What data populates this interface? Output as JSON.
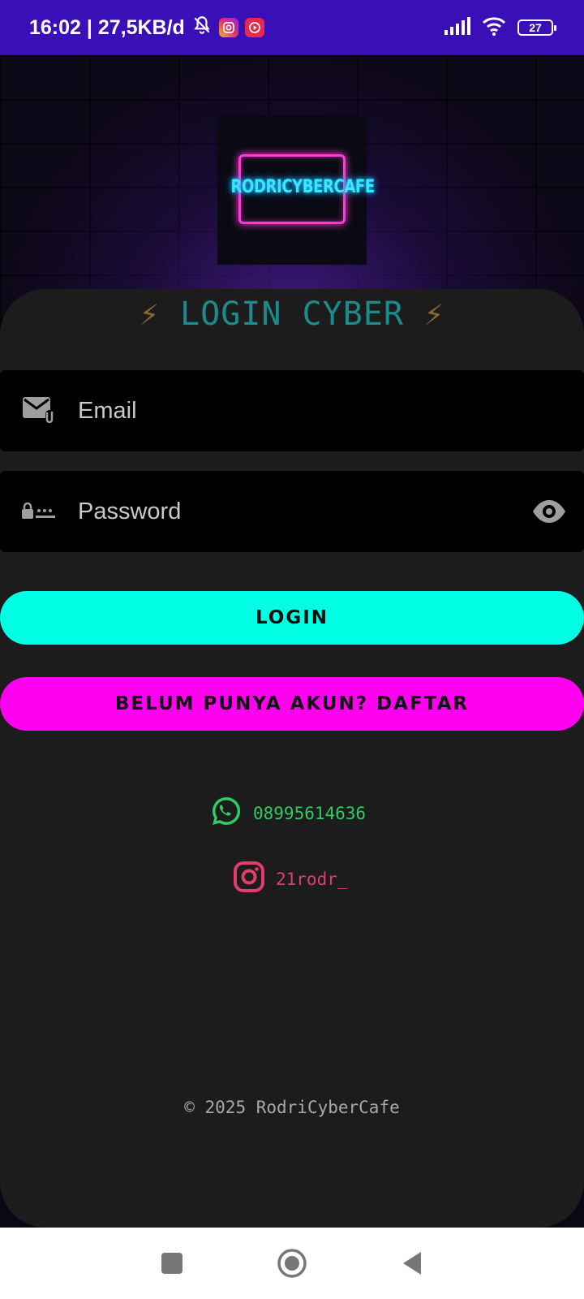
{
  "status_bar": {
    "time_speed": "16:02 | 27,5KB/d",
    "battery": "27",
    "icons": [
      "bell-off-icon",
      "instagram-notification-icon",
      "video-notification-icon",
      "signal-icon",
      "wifi-icon",
      "battery-icon"
    ]
  },
  "logo": {
    "text": "RODRICYBERCAFE"
  },
  "title": {
    "bolt_left": "⚡",
    "text": "LOGIN CYBER",
    "bolt_right": "⚡"
  },
  "form": {
    "email_placeholder": "Email",
    "password_placeholder": "Password"
  },
  "buttons": {
    "login": "LOGIN",
    "register": "BELUM PUNYA AKUN? DAFTAR"
  },
  "contacts": {
    "whatsapp": "08995614636",
    "instagram": "21rodr_"
  },
  "footer": {
    "copyright": "© 2025 RodriCyberCafe"
  },
  "colors": {
    "status_bar": "#3a0fb8",
    "card": "#1c1c1c",
    "title": "#1d8a8c",
    "login_button": "#00ffe4",
    "register_button": "#ff00f0",
    "whatsapp": "#2ecc62",
    "instagram": "#e43d6b"
  }
}
